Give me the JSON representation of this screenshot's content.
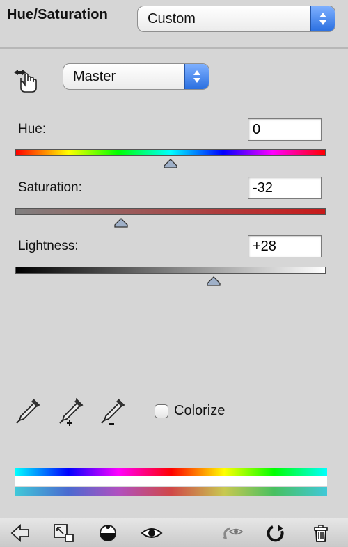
{
  "panel": {
    "title": "Hue/Saturation",
    "preset": {
      "value": "Custom"
    }
  },
  "channel": {
    "value": "Master"
  },
  "adjustments": {
    "hue": {
      "label": "Hue:",
      "value": "0",
      "level": 0
    },
    "saturation": {
      "label": "Saturation:",
      "value": "-32",
      "level": -32
    },
    "lightness": {
      "label": "Lightness:",
      "value": "+28",
      "level": 28
    }
  },
  "colorize": {
    "label": "Colorize",
    "checked": false
  },
  "icons": {
    "adjust_tool": "hand-scrubby-icon",
    "eyedropper": "eyedropper-icon",
    "eyedropper_add": "eyedropper-plus-icon",
    "eyedropper_subtract": "eyedropper-minus-icon",
    "bottom": [
      "back-arrow-icon",
      "clip-to-layer-icon",
      "layer-mask-icon",
      "visibility-eye-icon",
      "previous-state-icon",
      "reset-icon",
      "trash-icon"
    ]
  },
  "colors": {
    "panel_bg": "#d6d6d6",
    "popup_arrow": "#2a6fe0"
  }
}
